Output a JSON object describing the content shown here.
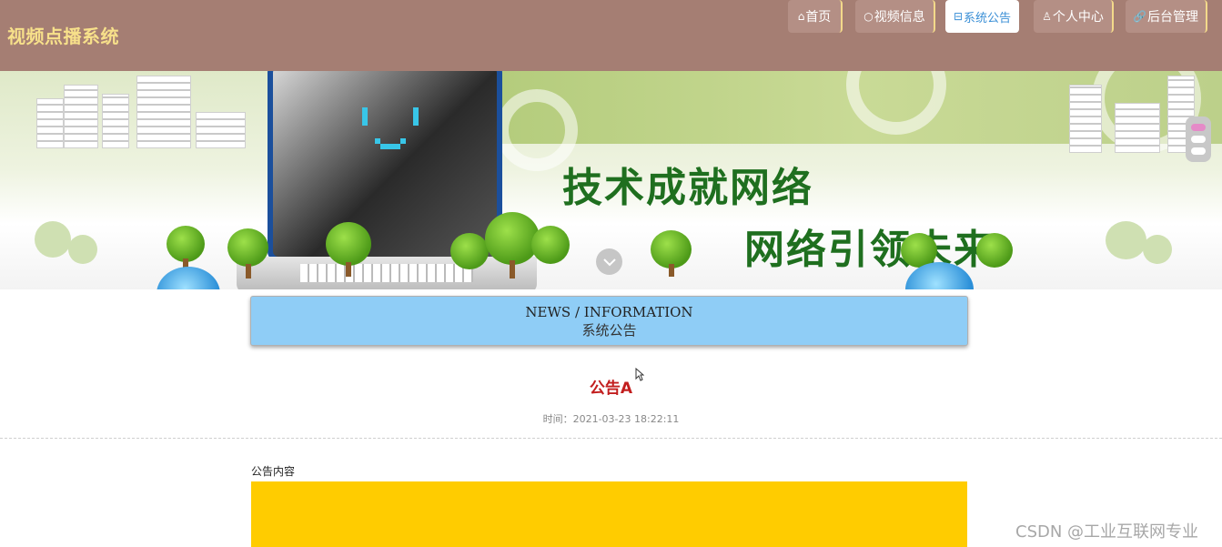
{
  "header": {
    "site_title": "视频点播系统",
    "nav": [
      {
        "icon": "⌂",
        "label": "首页",
        "active": false
      },
      {
        "icon": "○",
        "label": "视频信息",
        "active": false
      },
      {
        "icon": "⊟",
        "label": "系统公告",
        "active": true
      },
      {
        "icon": "♙",
        "label": "个人中心",
        "active": false
      },
      {
        "icon": "🔗",
        "label": "后台管理",
        "active": false
      }
    ]
  },
  "banner": {
    "slogan_line1": "技术成就网络",
    "slogan_line2": "网络引领未来",
    "face": "| |  ‿"
  },
  "section": {
    "title_en": "NEWS / INFORMATION",
    "title_cn": "系统公告"
  },
  "notice": {
    "title": "公告A",
    "time": "时间：2021-03-23 18:22:11",
    "content_label": "公告内容"
  },
  "watermark": "CSDN @工业互联网专业",
  "colors": {
    "header_bg": "#a57e73",
    "site_title": "#f7e08a",
    "title_box_bg": "#8fcdf6",
    "notice_title": "#c21e1e",
    "content_box": "#ffcc00"
  }
}
